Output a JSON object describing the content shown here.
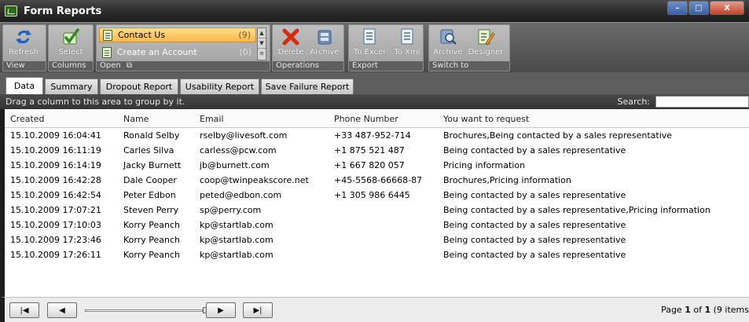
{
  "window": {
    "title": "Form Reports",
    "min_glyph": "–",
    "max_glyph": "□",
    "close_glyph": "X"
  },
  "ribbon": {
    "view": {
      "label": "View",
      "refresh": "Refresh"
    },
    "columns": {
      "label": "Columns",
      "select": "Select"
    },
    "open": {
      "label": "Open",
      "items": [
        {
          "name": "Contact Us",
          "count": "(9)"
        },
        {
          "name": "Create an Account",
          "count": "(0)"
        }
      ]
    },
    "operations": {
      "label": "Operations",
      "delete": "Delete",
      "archive": "Archive"
    },
    "export": {
      "label": "Export",
      "excel": "To Excel",
      "xml": "To Xml"
    },
    "switch": {
      "label": "Switch to",
      "archive": "Archive",
      "designer": "Designer"
    }
  },
  "tabs": [
    "Data",
    "Summary",
    "Dropout Report",
    "Usability Report",
    "Save Failure Report"
  ],
  "group_panel": {
    "hint": "Drag a column to this area to group by it.",
    "search_label": "Search:",
    "search_value": ""
  },
  "columns": [
    "Created",
    "Name",
    "Email",
    "Phone Number",
    "You want to request"
  ],
  "rows": [
    [
      "15.10.2009 16:04:41",
      "Ronald Selby",
      "rselby@livesoft.com",
      "+33 487-952-714",
      "Brochures,Being contacted by a sales representative"
    ],
    [
      "15.10.2009 16:11:19",
      "Carles Silva",
      "carless@pcw.com",
      "+1 875 521 487",
      "Being contacted by a sales representative"
    ],
    [
      "15.10.2009 16:14:19",
      "Jacky Burnett",
      "jb@burnett.com",
      "+1 667 820 057",
      "Pricing information"
    ],
    [
      "15.10.2009 16:42:28",
      "Dale Cooper",
      "coop@twinpeakscore.net",
      "+45-5568-66668-87",
      "Brochures,Pricing information"
    ],
    [
      "15.10.2009 16:42:54",
      "Peter Edbon",
      "peted@edbon.com",
      "+1 305 986 6445",
      "Being contacted by a sales representative"
    ],
    [
      "15.10.2009 17:07:21",
      "Steven Perry",
      "sp@perry.com",
      "",
      "Being contacted by a sales representative,Pricing information"
    ],
    [
      "15.10.2009 17:10:03",
      "Korry Peanch",
      "kp@startlab.com",
      "",
      "Being contacted by a sales representative"
    ],
    [
      "15.10.2009 17:23:46",
      "Korry Peanch",
      "kp@startlab.com",
      "",
      "Being contacted by a sales representative"
    ],
    [
      "15.10.2009 17:26:11",
      "Korry Peanch",
      "kp@startlab.com",
      "",
      "Being contacted by a sales representative"
    ]
  ],
  "pager": {
    "first": "|◀",
    "prev": "◀",
    "next": "▶",
    "last": "▶|",
    "page_prefix": "Page ",
    "page_current": "1",
    "page_of": " of ",
    "page_total": "1",
    "items_text": " (9 items"
  },
  "colors": {
    "accent_selected": "#ffb84a",
    "ribbon_bg": "#4b4b4b",
    "titlebar_bg": "#2a2a2a"
  }
}
